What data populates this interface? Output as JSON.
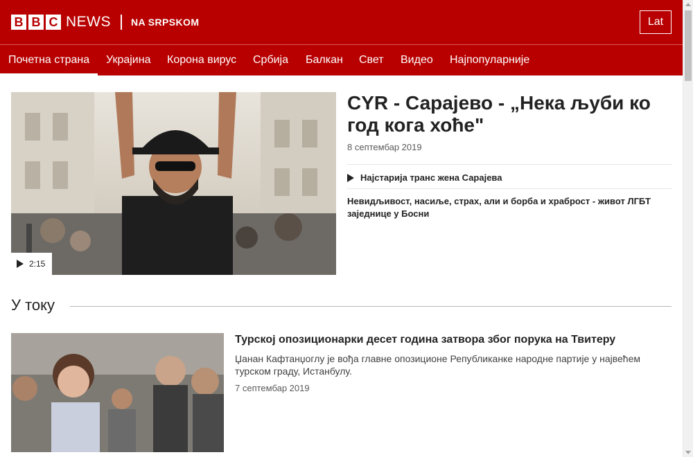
{
  "header": {
    "logo_letters": [
      "B",
      "B",
      "C"
    ],
    "logo_news": "NEWS",
    "logo_sub": "NA SRPSKOM",
    "script_toggle": "Lat",
    "brand_color": "#b80000"
  },
  "nav": {
    "items": [
      {
        "label": "Почетна страна",
        "active": true
      },
      {
        "label": "Украјина",
        "active": false
      },
      {
        "label": "Корона вирус",
        "active": false
      },
      {
        "label": "Србија",
        "active": false
      },
      {
        "label": "Балкан",
        "active": false
      },
      {
        "label": "Свет",
        "active": false
      },
      {
        "label": "Видео",
        "active": false
      },
      {
        "label": "Најпопуларније",
        "active": false
      }
    ]
  },
  "hero": {
    "image_icon": "photo-placeholder",
    "media_icon": "play-icon",
    "duration": "2:15",
    "title": "CYR - Сарајево - „Нека љуби ко год кога хоће\"",
    "date": "8 септембар 2019",
    "related_1": "Најстарија транс жена Сарајева",
    "related_2": "Невидљивост, насиље, страх, али и борба и храброст - живот ЛГБТ заједнице у Босни"
  },
  "section": {
    "title": "У току"
  },
  "story": {
    "title": "Турској опозиционарки десет година затвора због порука на Твитеру",
    "summary": "Џанан Кафтанџоглу је вођа главне опозиционе Републиканке народне партије у највећем турском граду, Истанбулу.",
    "date": "7 септембар 2019"
  }
}
